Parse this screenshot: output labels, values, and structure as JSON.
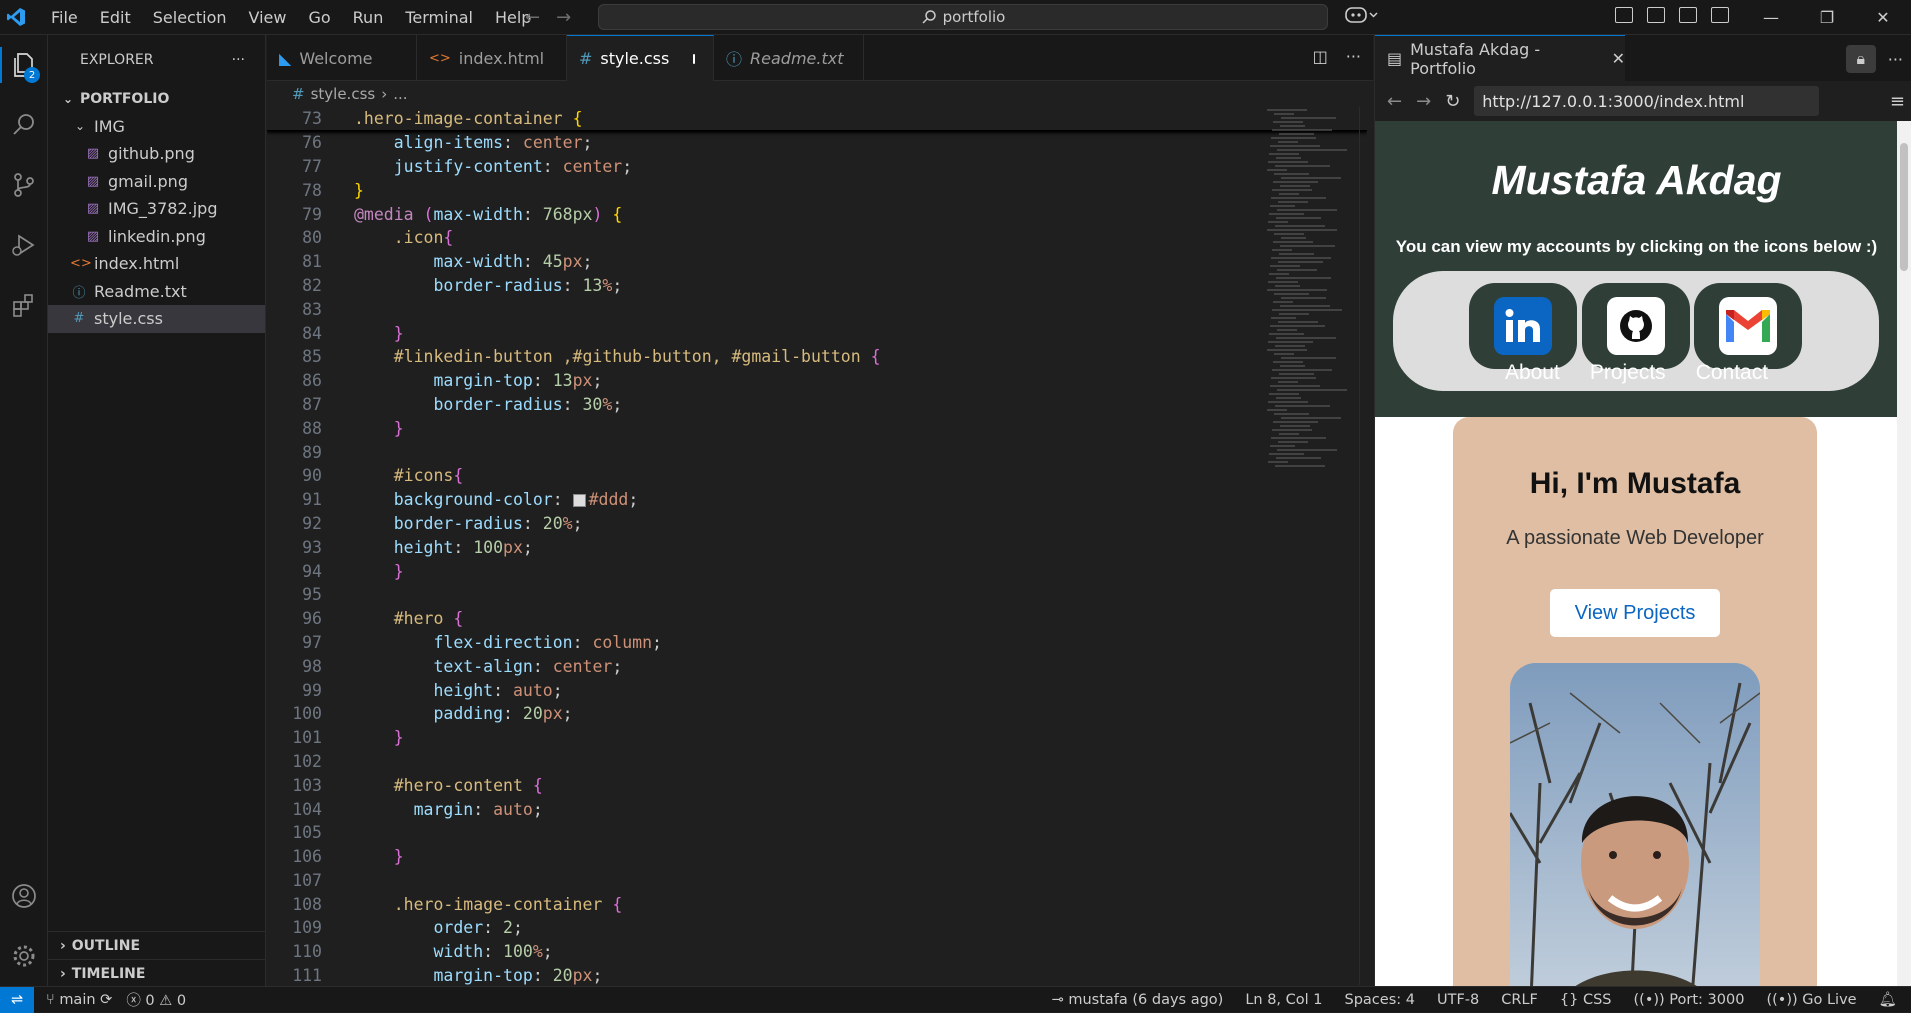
{
  "menu": [
    "File",
    "Edit",
    "Selection",
    "View",
    "Go",
    "Run",
    "Terminal",
    "Help"
  ],
  "search": {
    "label": "portfolio"
  },
  "activity": {
    "explorer_badge": "2"
  },
  "explorer": {
    "title": "EXPLORER",
    "root": "PORTFOLIO",
    "folder": "IMG",
    "img_files": [
      "github.png",
      "gmail.png",
      "IMG_3782.jpg",
      "linkedin.png"
    ],
    "root_files": [
      "index.html",
      "Readme.txt",
      "style.css"
    ],
    "outline": "OUTLINE",
    "timeline": "TIMELINE"
  },
  "tabs": [
    {
      "label": "Welcome"
    },
    {
      "label": "index.html"
    },
    {
      "label": "style.css"
    },
    {
      "label": "Readme.txt"
    }
  ],
  "breadcrumb": {
    "file": "style.css",
    "more": "..."
  },
  "code": {
    "sticky": {
      "ln": "73",
      "text": ".hero-image-container {"
    },
    "lines": [
      {
        "ln": "76",
        "text": "    align-items: center;"
      },
      {
        "ln": "77",
        "text": "    justify-content: center;"
      },
      {
        "ln": "78",
        "text": "}"
      },
      {
        "ln": "79",
        "text": "@media (max-width: 768px) {"
      },
      {
        "ln": "80",
        "text": "    .icon{"
      },
      {
        "ln": "81",
        "text": "        max-width: 45px;"
      },
      {
        "ln": "82",
        "text": "        border-radius: 13%;"
      },
      {
        "ln": "83",
        "text": ""
      },
      {
        "ln": "84",
        "text": "    }"
      },
      {
        "ln": "85",
        "text": "    #linkedin-button ,#github-button, #gmail-button {"
      },
      {
        "ln": "86",
        "text": "        margin-top: 13px;"
      },
      {
        "ln": "87",
        "text": "        border-radius: 30%;"
      },
      {
        "ln": "88",
        "text": "    }"
      },
      {
        "ln": "89",
        "text": ""
      },
      {
        "ln": "90",
        "text": "    #icons{"
      },
      {
        "ln": "91",
        "text": "    background-color: #ddd;"
      },
      {
        "ln": "92",
        "text": "    border-radius: 20%;"
      },
      {
        "ln": "93",
        "text": "    height: 100px;"
      },
      {
        "ln": "94",
        "text": "    }"
      },
      {
        "ln": "95",
        "text": ""
      },
      {
        "ln": "96",
        "text": "    #hero {"
      },
      {
        "ln": "97",
        "text": "        flex-direction: column;"
      },
      {
        "ln": "98",
        "text": "        text-align: center;"
      },
      {
        "ln": "99",
        "text": "        height: auto;"
      },
      {
        "ln": "100",
        "text": "        padding: 20px;"
      },
      {
        "ln": "101",
        "text": "    }"
      },
      {
        "ln": "102",
        "text": ""
      },
      {
        "ln": "103",
        "text": "    #hero-content {"
      },
      {
        "ln": "104",
        "text": "      margin: auto;"
      },
      {
        "ln": "105",
        "text": ""
      },
      {
        "ln": "106",
        "text": "    }"
      },
      {
        "ln": "107",
        "text": ""
      },
      {
        "ln": "108",
        "text": "    .hero-image-container {"
      },
      {
        "ln": "109",
        "text": "        order: 2;"
      },
      {
        "ln": "110",
        "text": "        width: 100%;"
      },
      {
        "ln": "111",
        "text": "        margin-top: 20px;"
      }
    ]
  },
  "browser": {
    "tab_title": "Mustafa Akdag - Portfolio",
    "url": "http://127.0.0.1:3000/index.html",
    "site": {
      "title": "Mustafa Akdag",
      "subtitle": "You can view my accounts by clicking on the icons below :)",
      "nav": [
        "About",
        "Projects",
        "Contact"
      ],
      "hero_heading": "Hi, I'm Mustafa",
      "hero_text": "A passionate Web Developer",
      "cta": "View Projects"
    }
  },
  "status": {
    "branch": "main",
    "problems": "0",
    "warnings": "0",
    "blame": "mustafa (6 days ago)",
    "position": "Ln 8, Col 1",
    "spaces": "Spaces: 4",
    "encoding": "UTF-8",
    "eol": "CRLF",
    "language": "CSS",
    "port": "Port: 3000",
    "golive": "Go Live"
  },
  "colors": {
    "accent": "#0078d4",
    "header_bg": "#2f3e37",
    "hero_bg": "#dfbea3",
    "icons_bar": "#dddddd"
  }
}
